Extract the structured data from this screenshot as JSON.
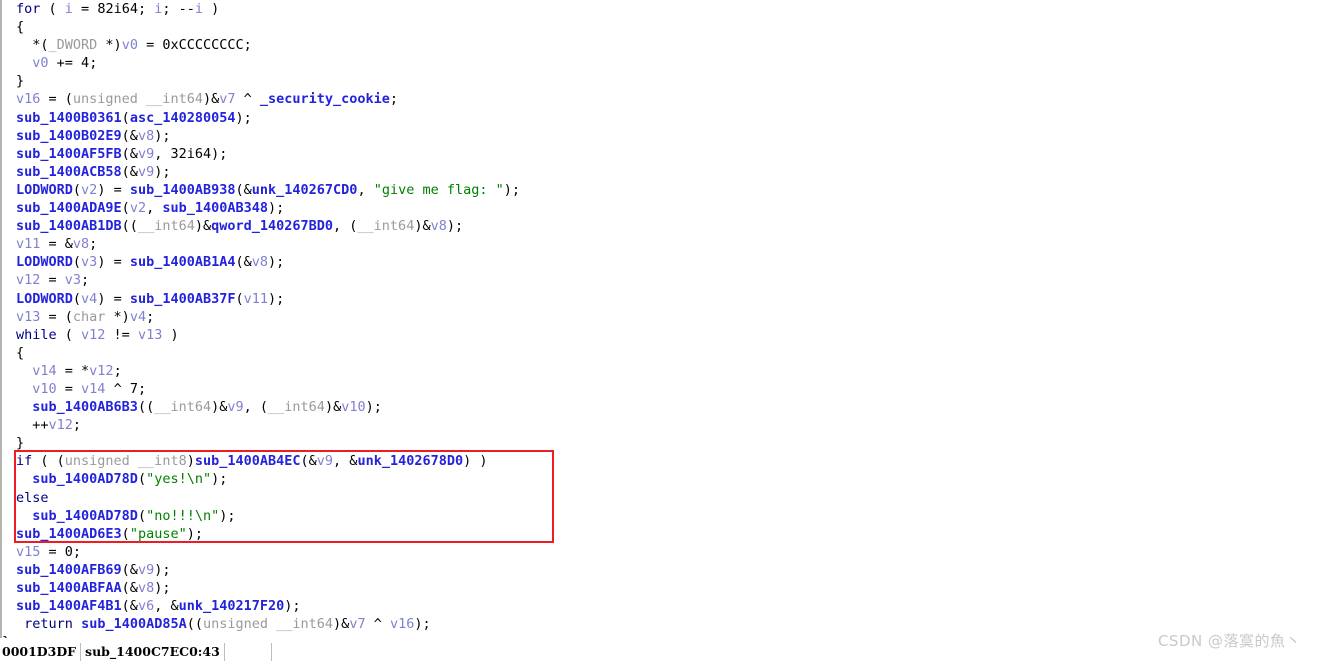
{
  "app": {
    "name": "IDA Pro Hex-Rays pseudocode view",
    "function_signature_label": "sub_1400C7EC0"
  },
  "colors": {
    "keyword": "#00007f",
    "function": "#2323dc",
    "variable": "#8080d0",
    "type": "#9a9a9a",
    "string": "#008000",
    "annotation_box": "#ee1c25",
    "background": "#ffffff",
    "watermark": "#c9c9c9"
  },
  "code": {
    "lines": [
      "for ( i = 82i64; i; --i )",
      "{",
      "  *(_DWORD *)v0 = 0xCCCCCCCC;",
      "  v0 += 4;",
      "}",
      "v16 = (unsigned __int64)&v7 ^ _security_cookie;",
      "sub_1400B0361(asc_140280054);",
      "sub_1400B02E9(&v8);",
      "sub_1400AF5FB(&v9, 32i64);",
      "sub_1400ACB58(&v9);",
      "LODWORD(v2) = sub_1400AB938(&unk_140267CD0, \"give me flag: \");",
      "sub_1400ADA9E(v2, sub_1400AB348);",
      "sub_1400AB1DB((__int64)&qword_140267BD0, (__int64)&v8);",
      "v11 = &v8;",
      "LODWORD(v3) = sub_1400AB1A4(&v8);",
      "v12 = v3;",
      "LODWORD(v4) = sub_1400AB37F(v11);",
      "v13 = (char *)v4;",
      "while ( v12 != v13 )",
      "{",
      "  v14 = *v12;",
      "  v10 = v14 ^ 7;",
      "  sub_1400AB6B3((__int64)&v9, (__int64)&v10);",
      "  ++v12;",
      "}",
      "if ( (unsigned __int8)sub_1400AB4EC(&v9, &unk_1402678D0) )",
      "  sub_1400AD78D(\"yes!\\n\");",
      "else",
      "  sub_1400AD78D(\"no!!!\\n\");",
      "sub_1400AD6E3(\"pause\");",
      "v15 = 0;",
      "sub_1400AFB69(&v9);",
      "sub_1400ABFAA(&v8);",
      "sub_1400AF4B1(&v6, &unk_140217F20);",
      "return sub_1400AD85A((unsigned __int64)&v7 ^ v16);",
      "}"
    ],
    "highlighted_lines": [
      "if ( (unsigned __int8)sub_1400AB4EC(&v9, &unk_1402678D0) )",
      "  sub_1400AD78D(\"yes!\\n\");",
      "else",
      "  sub_1400AD78D(\"no!!!\\n\");",
      "sub_1400AD6E3(\"pause\");"
    ],
    "strings_visible": [
      "give me flag: ",
      "yes!\\n",
      "no!!!\\n",
      "pause"
    ]
  },
  "status_bar": {
    "offset": "0001D3DF",
    "location": "sub_1400C7EC0:43"
  },
  "watermark": {
    "text": "CSDN @落寞的魚丶"
  }
}
